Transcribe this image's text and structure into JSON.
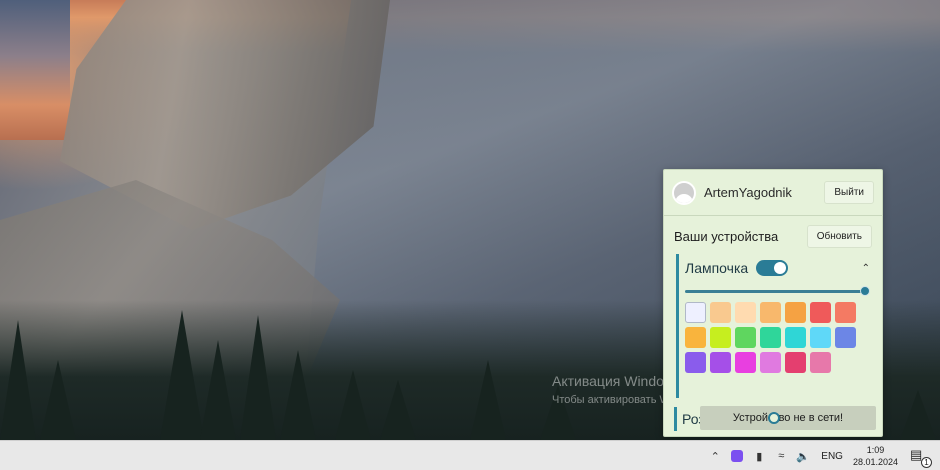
{
  "popup": {
    "username": "ArtemYagodnik",
    "logout_label": "Выйти",
    "devices_title": "Ваши устройства",
    "refresh_label": "Обновить",
    "devices": [
      {
        "name": "Лампочка",
        "on": true,
        "brightness_percent": 100,
        "colors": [
          "#eef0ff",
          "#f9c98f",
          "#ffdbb0",
          "#f8b86c",
          "#f5a243",
          "#ef5a5a",
          "#f47a63",
          "#f9b43d",
          "#c6ee1f",
          "#5fd65f",
          "#2fd69a",
          "#2fd6d6",
          "#5fd8f8",
          "#6c86e6",
          "#8a5cec",
          "#a54fe8",
          "#e83fe0",
          "#e07ae0",
          "#e43f6f",
          "#e778aa"
        ]
      },
      {
        "name": "Розетка"
      }
    ],
    "toast": "Устройство не в сети!"
  },
  "activation": {
    "title": "Активация Windows",
    "subtitle": "Чтобы активировать Windows, перейдите в раздел \"Параметры\""
  },
  "taskbar": {
    "language": "ENG",
    "time": "1:09",
    "date": "28.01.2024",
    "notification_count": "1"
  }
}
